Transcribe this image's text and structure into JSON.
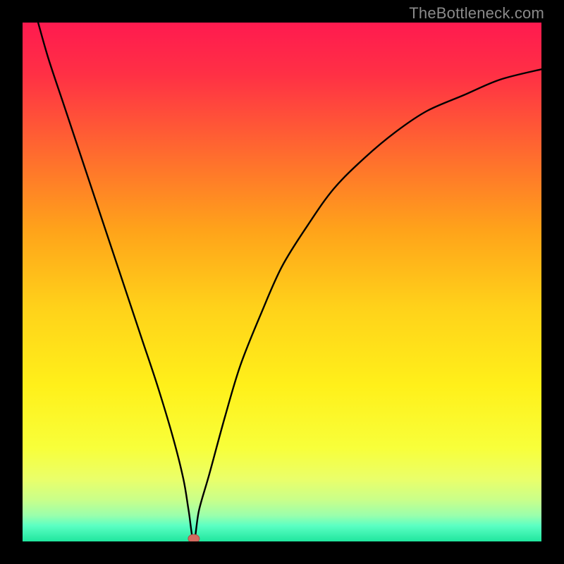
{
  "watermark": "TheBottleneck.com",
  "colors": {
    "frame": "#000000",
    "watermark": "#8a8a8a",
    "curve": "#000000",
    "marker_fill": "#d46a5f",
    "marker_stroke": "#af4f49",
    "gradient_stops": [
      {
        "offset": 0.0,
        "color": "#ff1a4f"
      },
      {
        "offset": 0.1,
        "color": "#ff3045"
      },
      {
        "offset": 0.25,
        "color": "#ff6a2f"
      },
      {
        "offset": 0.4,
        "color": "#ffa31a"
      },
      {
        "offset": 0.55,
        "color": "#ffd21a"
      },
      {
        "offset": 0.7,
        "color": "#fff01a"
      },
      {
        "offset": 0.82,
        "color": "#f8ff3a"
      },
      {
        "offset": 0.88,
        "color": "#eaff6a"
      },
      {
        "offset": 0.92,
        "color": "#c9ff8a"
      },
      {
        "offset": 0.95,
        "color": "#9affac"
      },
      {
        "offset": 0.97,
        "color": "#5affc3"
      },
      {
        "offset": 1.0,
        "color": "#20e69e"
      }
    ]
  },
  "chart_data": {
    "type": "line",
    "title": "",
    "xlabel": "",
    "ylabel": "",
    "xlim": [
      0,
      100
    ],
    "ylim": [
      0,
      100
    ],
    "grid": false,
    "legend": false,
    "marker": {
      "x": 33,
      "y": 0
    },
    "series": [
      {
        "name": "curve",
        "x": [
          3,
          5,
          8,
          11,
          14,
          17,
          20,
          23,
          26,
          29,
          31,
          32,
          33,
          34,
          36,
          39,
          42,
          46,
          50,
          55,
          60,
          66,
          72,
          78,
          85,
          92,
          100
        ],
        "y": [
          100,
          93,
          84,
          75,
          66,
          57,
          48,
          39,
          30,
          20,
          12,
          6,
          0,
          6,
          13,
          24,
          34,
          44,
          53,
          61,
          68,
          74,
          79,
          83,
          86,
          89,
          91
        ]
      }
    ]
  }
}
